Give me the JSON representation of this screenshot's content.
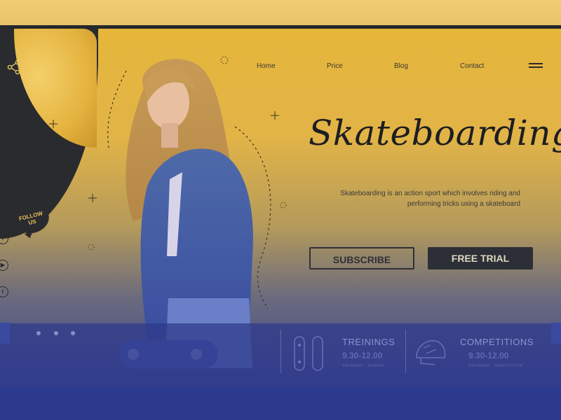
{
  "nav": {
    "items": [
      "Home",
      "Price",
      "Blog",
      "Contact"
    ]
  },
  "sidebar": {
    "follow_line1": "FOLLOW",
    "follow_line2": "US",
    "social": [
      {
        "icon": "facebook-icon",
        "glyph": "f"
      },
      {
        "icon": "youtube-icon",
        "glyph": "▶"
      },
      {
        "icon": "twitter-icon",
        "glyph": "t"
      }
    ]
  },
  "hero": {
    "title": "Skateboarding",
    "description": "Skateboarding is an action sport which involves riding and performing tricks using a skateboard",
    "subscribe_label": "SUBSCRIBE",
    "trial_label": "FREE TRIAL"
  },
  "cards": [
    {
      "title": "TREININGS",
      "time": "9.30-12.00",
      "sub": "SATURDAY · SUNDAY",
      "icon": "skateboard-icon"
    },
    {
      "title": "COMPETITIONS",
      "time": "9.30-12.00",
      "sub": "SATURDAY · COMPETITION",
      "icon": "helmet-icon"
    }
  ],
  "colors": {
    "accent_yellow": "#e6b63a",
    "dark": "#2a2b2e",
    "panel_blue": "#2e398a"
  }
}
